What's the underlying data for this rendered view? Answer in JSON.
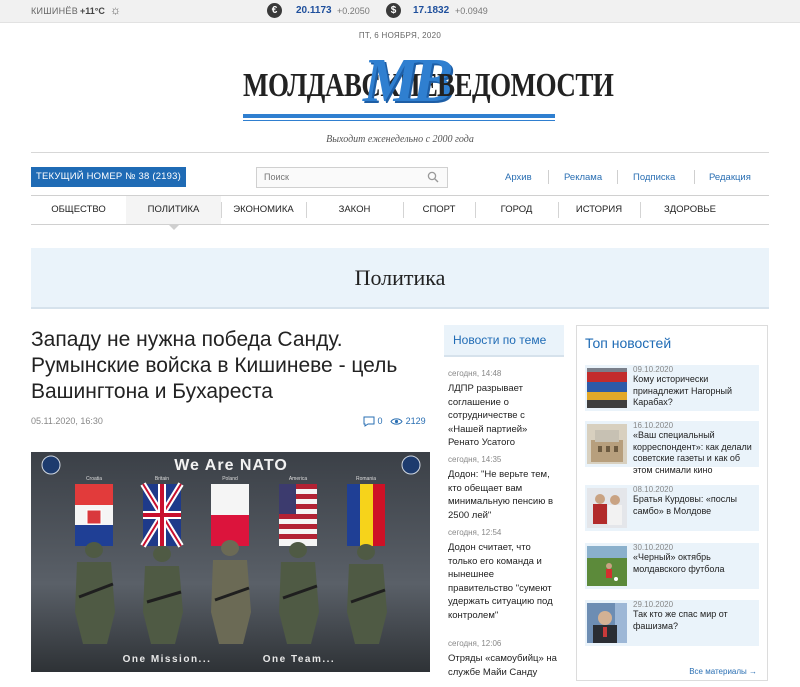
{
  "topbar": {
    "city": "КИШИНЁВ",
    "temp": "+11°C",
    "weather_icon": "sun-icon",
    "currencies": [
      {
        "symbol": "€",
        "rate": "20.1173",
        "change": "+0.2050"
      },
      {
        "symbol": "$",
        "rate": "17.1832",
        "change": "+0.0949"
      }
    ]
  },
  "header": {
    "date": "ПТ, 6 НОЯБРЯ, 2020",
    "logo_left": "МОЛДАВСКИЕ",
    "logo_mv": "MB",
    "logo_right": "ВЕДОМОСТИ",
    "tagline": "Выходит еженедельно с 2000 года"
  },
  "toolbar": {
    "issue_label": "ТЕКУЩИЙ НОМЕР № 38 (2193)",
    "search_placeholder": "Поиск",
    "links": [
      "Архив",
      "Реклама",
      "Подписка",
      "Редакция"
    ]
  },
  "nav": {
    "items": [
      "ОБЩЕСТВО",
      "ПОЛИТИКА",
      "ЭКОНОМИКА",
      "ЗАКОН",
      "СПОРТ",
      "ГОРОД",
      "ИСТОРИЯ",
      "ЗДОРОВЬЕ"
    ],
    "active": "ПОЛИТИКА"
  },
  "section": {
    "title": "Политика"
  },
  "article": {
    "title": "Западу не нужна победа Санду. Румынские войска в Кишиневе - цель Вашингтона и Бухареста",
    "date": "05.11.2020, 16:30",
    "comments": "0",
    "views": "2129",
    "image": {
      "banner": "We Are NATO",
      "flags": [
        "Croatia",
        "Britain",
        "Poland",
        "America",
        "Romania"
      ],
      "footer_left": "One Mission...",
      "footer_right": "One Team..."
    }
  },
  "related": {
    "title": "Новости по теме",
    "items": [
      {
        "time": "сегодня, 14:48",
        "headline": "ЛДПР разрывает соглашение о сотрудничестве с «Нашей партией» Ренато Усатого"
      },
      {
        "time": "сегодня, 14:35",
        "headline": "Додон: \"Не верьте тем, кто обещает вам минимальную пенсию в 2500 лей\""
      },
      {
        "time": "сегодня, 12:54",
        "headline": "Додон считает, что только его команда и нынешнее правительство \"сумеют удержать ситуацию под контролем\""
      },
      {
        "time": "сегодня, 12:06",
        "headline": "Отряды «самоубийц» на службе Майи Санду"
      }
    ]
  },
  "topnews": {
    "title": "Топ новостей",
    "items": [
      {
        "date": "09.10.2020",
        "headline": "Кому исторически принадлежит Нагорный Карабах?"
      },
      {
        "date": "16.10.2020",
        "headline": "«Ваш специальный корреспондент»: как делали советские газеты и как об этом снимали кино"
      },
      {
        "date": "08.10.2020",
        "headline": "Братья Курдовы: «послы самбо» в Молдове"
      },
      {
        "date": "30.10.2020",
        "headline": "«Черный» октябрь молдавского футбола"
      },
      {
        "date": "29.10.2020",
        "headline": "Так кто же спас мир от фашизма?"
      }
    ],
    "all_label": "Все материалы →"
  },
  "colors": {
    "accent": "#1f6bb5",
    "band": "#eaf3fa",
    "logo": "#2f7fd0"
  }
}
